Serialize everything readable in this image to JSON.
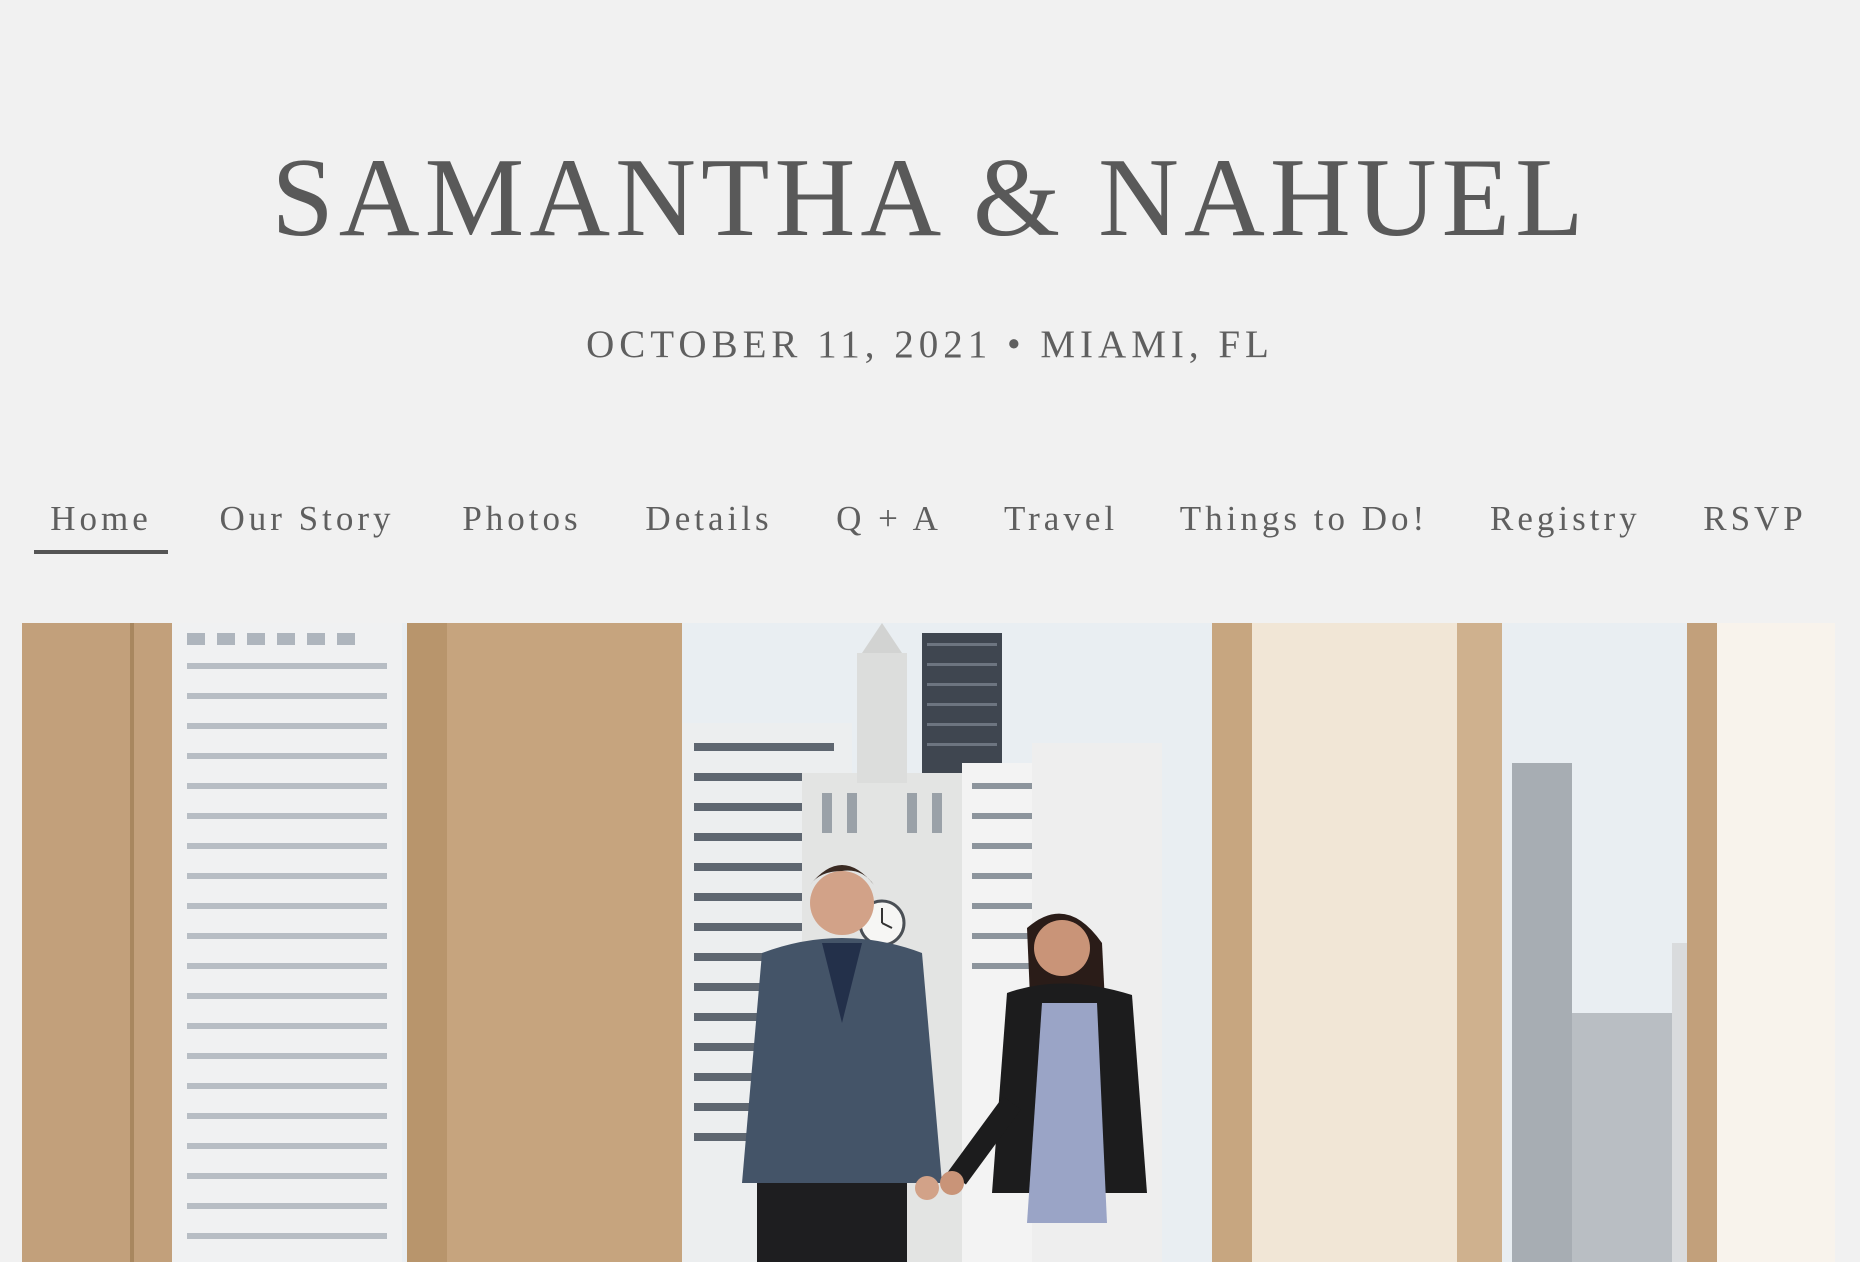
{
  "header": {
    "title": "SAMANTHA & NAHUEL",
    "subtitle": "OCTOBER 11, 2021 • MIAMI, FL"
  },
  "nav": {
    "active": "Home",
    "items": [
      {
        "label": "Home"
      },
      {
        "label": "Our Story"
      },
      {
        "label": "Photos"
      },
      {
        "label": "Details"
      },
      {
        "label": "Q + A"
      },
      {
        "label": "Travel"
      },
      {
        "label": "Things to Do!"
      },
      {
        "label": "Registry"
      },
      {
        "label": "RSVP"
      }
    ]
  },
  "hero": {
    "image_description_icon": "couple-photo",
    "colors": {
      "column": "#c3a27e",
      "column_light": "#f3e9dc",
      "sky": "#e8edf1",
      "building": "#e2e4e6",
      "tower_dark": "#3f4650"
    }
  }
}
